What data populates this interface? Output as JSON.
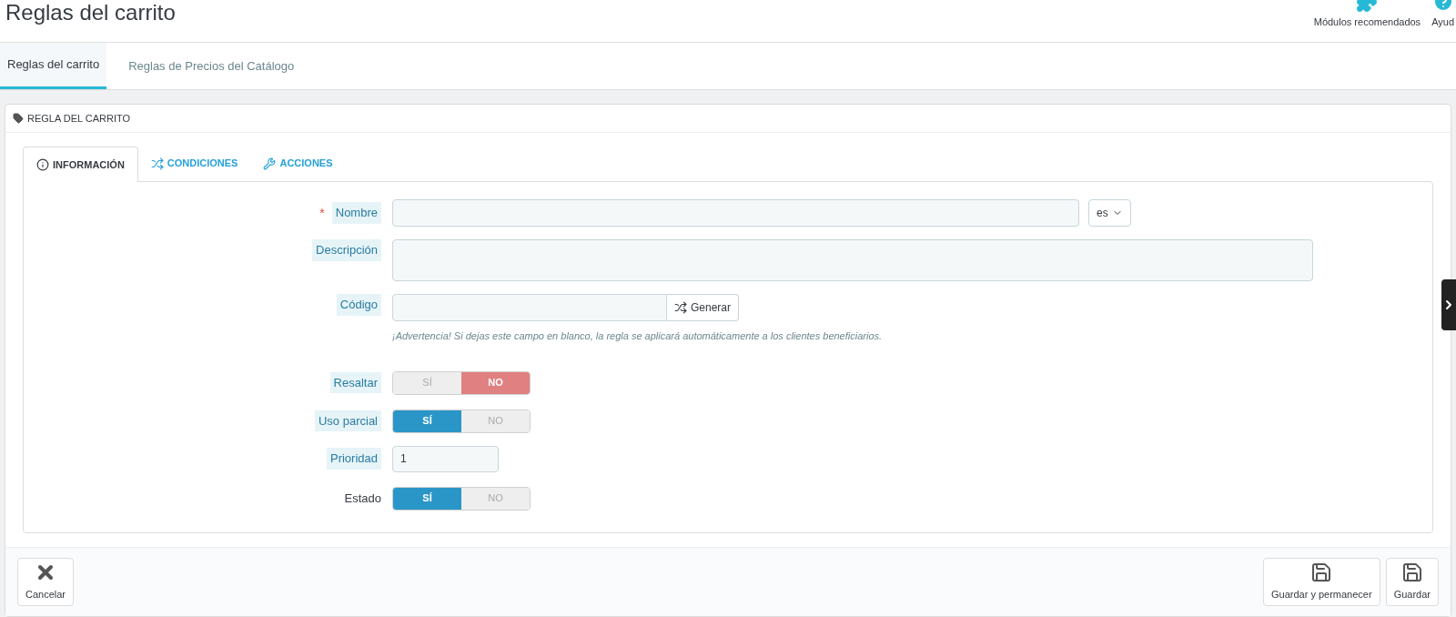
{
  "header": {
    "title": "Reglas del carrito",
    "toolbar": [
      {
        "kind": "puzzle",
        "label": "Módulos recomendados"
      },
      {
        "kind": "help",
        "label": "Ayud"
      }
    ]
  },
  "tabs": [
    {
      "label": "Reglas del carrito",
      "selected": true
    },
    {
      "label": "Reglas de Precios del Catálogo",
      "selected": false
    }
  ],
  "panel": {
    "title": "REGLA DEL CARRITO",
    "tabs": [
      {
        "kind": "info",
        "label": "INFORMACIÓN",
        "selected": true
      },
      {
        "kind": "shuffle",
        "label": "CONDICIONES",
        "selected": false
      },
      {
        "kind": "wrench",
        "label": "ACCIONES",
        "selected": false
      }
    ],
    "fields": [
      {
        "kind": "text",
        "label": "Nombre",
        "required_mark": "*",
        "hint": true,
        "language": "es"
      },
      {
        "kind": "textarea",
        "label": "Descripción",
        "hint": true
      },
      {
        "kind": "code",
        "label": "Código",
        "hint": true,
        "button": "Generar",
        "warning": "¡Advertencia! Si dejas este campo en blanco, la regla se aplicará automáticamente a los clientes beneficiarios."
      },
      {
        "kind": "switch",
        "label": "Resaltar",
        "hint": true,
        "options": [
          {
            "label": "SÍ",
            "selected": false
          },
          {
            "label": "NO",
            "selected": true
          }
        ]
      },
      {
        "kind": "switch",
        "label": "Uso parcial",
        "hint": true,
        "options": [
          {
            "label": "SÍ",
            "selected": true
          },
          {
            "label": "NO",
            "selected": false
          }
        ]
      },
      {
        "kind": "number",
        "label": "Prioridad",
        "hint": true,
        "value": "1"
      },
      {
        "kind": "switch",
        "label": "Estado",
        "hint": false,
        "options": [
          {
            "label": "SÍ",
            "selected": true
          },
          {
            "label": "NO",
            "selected": false
          }
        ]
      }
    ]
  },
  "footer": {
    "left": [
      {
        "kind": "close",
        "label": "Cancelar"
      }
    ],
    "right": [
      {
        "kind": "save",
        "label": "Guardar y permanecer"
      },
      {
        "kind": "save",
        "label": "Guardar"
      }
    ]
  }
}
